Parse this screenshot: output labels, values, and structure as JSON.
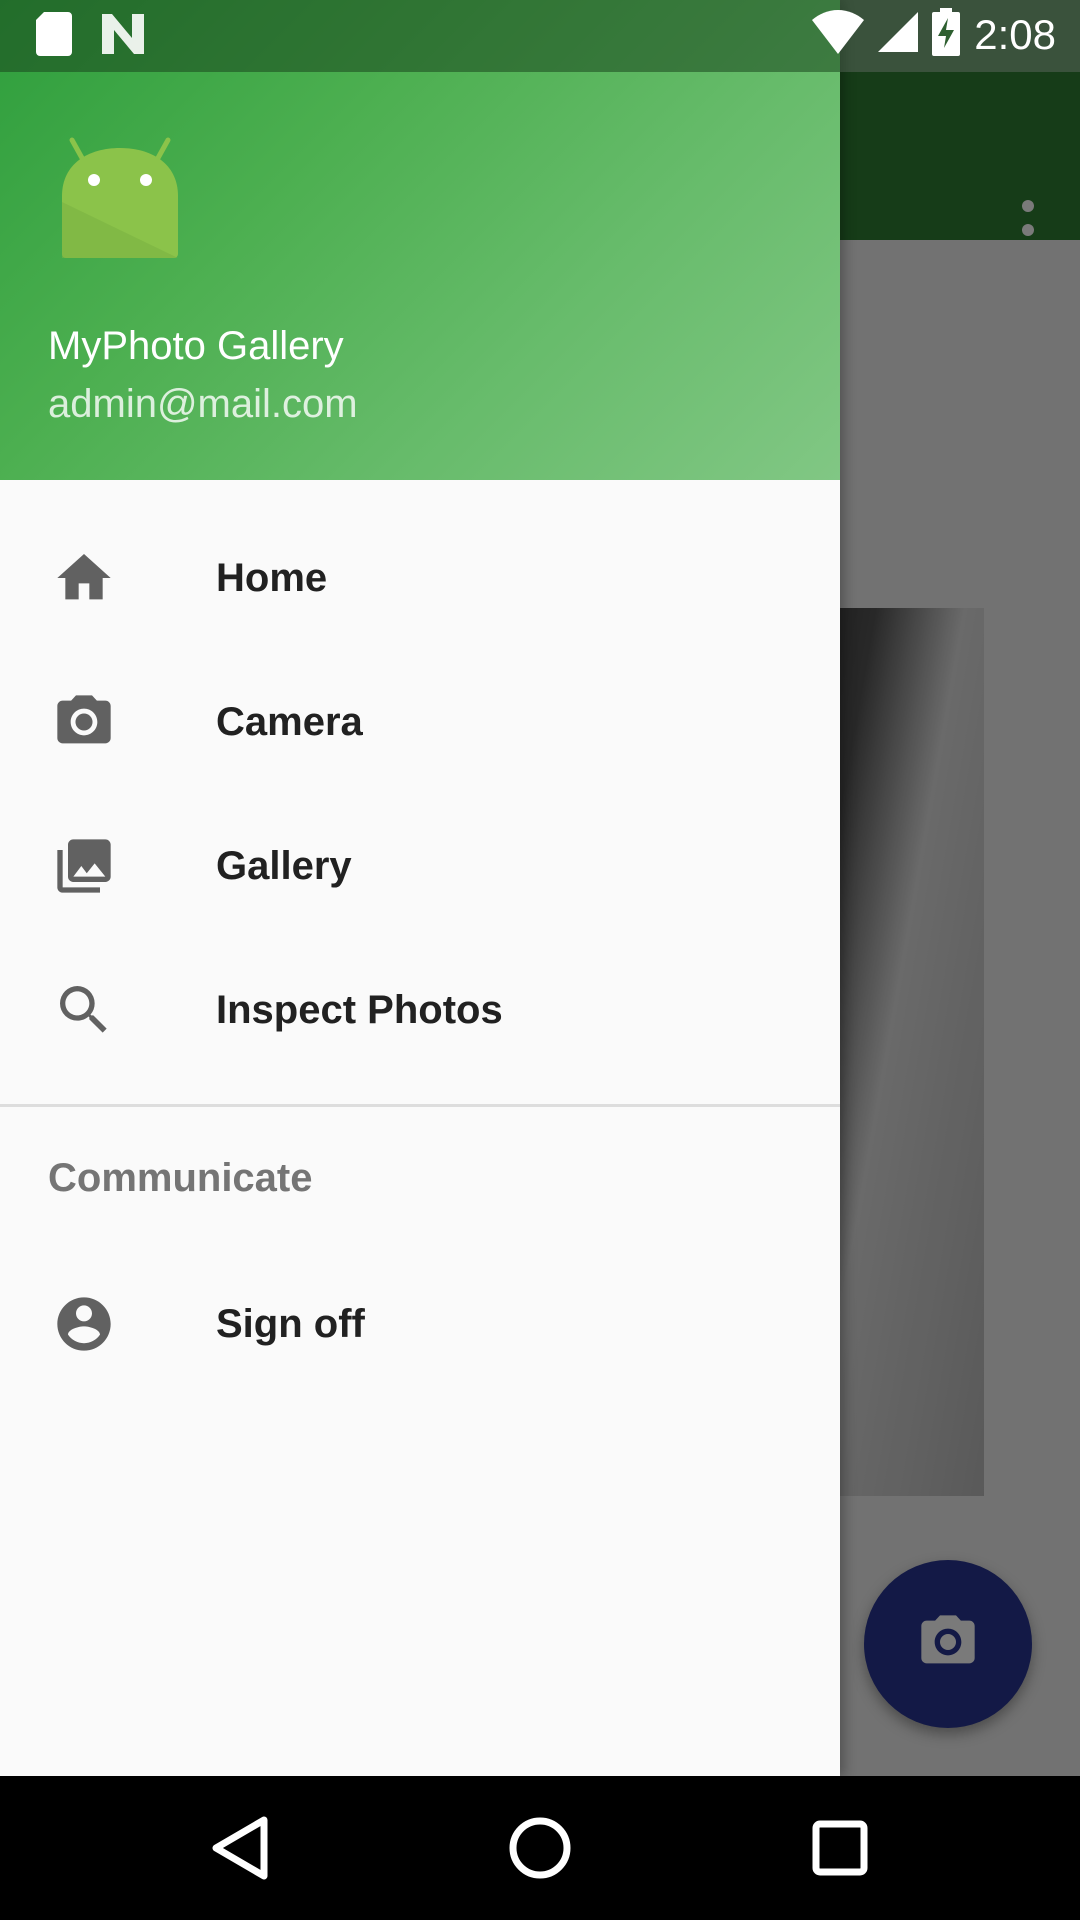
{
  "status_bar": {
    "time": "2:08",
    "icons": [
      "sd-card-icon",
      "n-logo-icon",
      "wifi-icon",
      "signal-icon",
      "battery-charging-icon"
    ]
  },
  "drawer": {
    "header": {
      "title": "MyPhoto Gallery",
      "email": "admin@mail.com",
      "avatar_icon": "android-icon"
    },
    "items": [
      {
        "label": "Home",
        "icon": "home-icon"
      },
      {
        "label": "Camera",
        "icon": "camera-icon"
      },
      {
        "label": "Gallery",
        "icon": "gallery-icon"
      },
      {
        "label": "Inspect Photos",
        "icon": "search-icon"
      }
    ],
    "section": {
      "title": "Communicate",
      "items": [
        {
          "label": "Sign off",
          "icon": "account-circle-icon"
        }
      ]
    }
  },
  "background_app": {
    "overflow_icon": "more-vert-icon",
    "fab_icon": "camera-icon"
  },
  "colors": {
    "header_start": "#2e9e3c",
    "header_end": "#81c784",
    "toolbar": "#2e7d32",
    "fab": "#283593",
    "drawer_bg": "#fafafa"
  },
  "nav_bar": {
    "buttons": [
      "back-icon",
      "home-circle-icon",
      "recents-icon"
    ]
  }
}
